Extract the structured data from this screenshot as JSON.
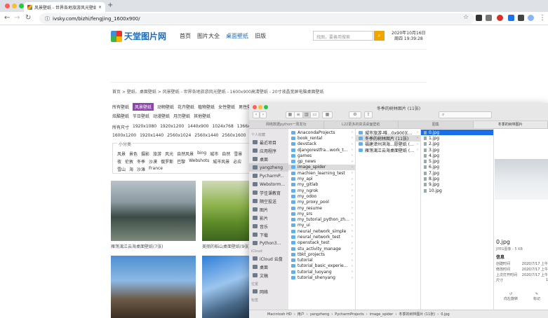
{
  "browser": {
    "tab_title": "风景壁纸 - 世界各地旅游风光壁纸",
    "url": "ivsky.com/bizhi/fengjing_1600x900/"
  },
  "site": {
    "logo": "天堂图片网",
    "nav": [
      "首页",
      "图片大全",
      "桌面壁纸",
      "旧版"
    ],
    "search_placeholder": "找图，要善用搜索",
    "date_line1": "2020年10月16日",
    "date_line2": "周四 19:39:28",
    "breadcrumb": "首页 > 壁纸、桌面壁纸 > 风景壁纸 - 世界各地旅游风光壁纸 - 1600x900高清壁纸 - 20寸液晶宽屏电脑桌面壁纸",
    "cat_row1": [
      "所有壁纸",
      "风景壁纸",
      "动物壁纸",
      "花卉壁纸",
      "植物壁纸",
      "女性壁纸",
      "男性壁纸"
    ],
    "cat_row2": [
      "炫酷壁纸",
      "节日壁纸",
      "动漫壁纸",
      "月历壁纸",
      "其他壁纸"
    ],
    "res_row1": [
      "所有尺寸",
      "1920x1080",
      "1920x1200",
      "1440x900",
      "1024x768",
      "1366x768"
    ],
    "res_row2": [
      "1600x1200",
      "1920x1440",
      "2560x1024",
      "2560x1440",
      "2560x1600",
      "256"
    ],
    "tags_header": "小分类",
    "tags": [
      "风景",
      "景色",
      "摄影",
      "旅游",
      "风光",
      "自然风景",
      "bing",
      "城市",
      "自然",
      "雪景",
      "夜",
      "伦敦",
      "冬季",
      "沙漠",
      "俄罗斯",
      "巴黎",
      "Webshots",
      "城市风景",
      "必应",
      "雪山",
      "海",
      "沙滩",
      "France"
    ],
    "photos": [
      {
        "caption": "雁荡漓江云海桌面壁纸(7张)"
      },
      {
        "caption": "美丽的稻山桌面壁纸(9张)"
      }
    ]
  },
  "finder": {
    "title": "冬季的树林图片 (11张)",
    "tabs": [
      "网络数据python一周发功",
      "L22更多的高清桌面壁纸",
      "图集",
      "冬季的树林图片"
    ],
    "sidebar": {
      "favorites_header": "个人收藏",
      "items": [
        "最近项目",
        "应用程序",
        "桌面",
        "yangzheng",
        "PycharmP...",
        "Webstorm...",
        "学佳课教育",
        "隔空投送",
        "图片",
        "影片",
        "音乐",
        "下载",
        "Python3..."
      ],
      "icloud_header": "iCloud",
      "icloud_items": [
        "iCloud 云盘",
        "桌面",
        "文稿"
      ],
      "locations_header": "位置",
      "locations_items": [
        "网络"
      ],
      "tags_header": "标签"
    },
    "col1": [
      "AnacondaProjects",
      "book_rental",
      "devstack",
      "djangorestfra...work_tutorial",
      "games",
      "gp_news",
      "image_spider",
      "machien_learning_test",
      "my_api",
      "my_gitlab",
      "my_ngrok",
      "my_odoo",
      "my_proxy_pool",
      "my_resume",
      "my_srs",
      "my_tutorial_python_zhiyou",
      "my_ui",
      "neural_network_simple",
      "neural_network_test",
      "openstack_test",
      "stu_activity_manage",
      "tbkt_projects",
      "tutorial",
      "tutorial_basic_experience",
      "tutorial_luoyang",
      "tutorial_shenyang"
    ],
    "col2": [
      "城市旅游-唯...0x900](20张)",
      "冬季的树林图片 (11张)",
      "福建漳州滨海...愿壁纸 (11张)",
      "雁荡漓江云海桌面壁纸 (7张)"
    ],
    "col3": [
      "0.jpg",
      "1.jpg",
      "2.jpg",
      "3.jpg",
      "4.jpg",
      "5.jpg",
      "6.jpg",
      "7.jpg",
      "8.jpg",
      "9.jpg",
      "10.jpg"
    ],
    "preview": {
      "name": "0.jpg",
      "kind": "JPEG图像 - 5 KB",
      "info_header": "信息",
      "rows": [
        [
          "创建时间",
          "2020/7/17 上午"
        ],
        [
          "修改时间",
          "2020/7/17 上午"
        ],
        [
          "上次打开时间",
          "2020/7/17 上午"
        ],
        [
          "尺寸",
          "1"
        ]
      ],
      "actions": [
        "向左旋转",
        "标记"
      ]
    },
    "path": [
      "Macintosh HD",
      "用户",
      "yangzheng",
      "PycharmProjects",
      "image_spider",
      "冬季的树林图片 (11张)",
      "0.jpg"
    ]
  }
}
